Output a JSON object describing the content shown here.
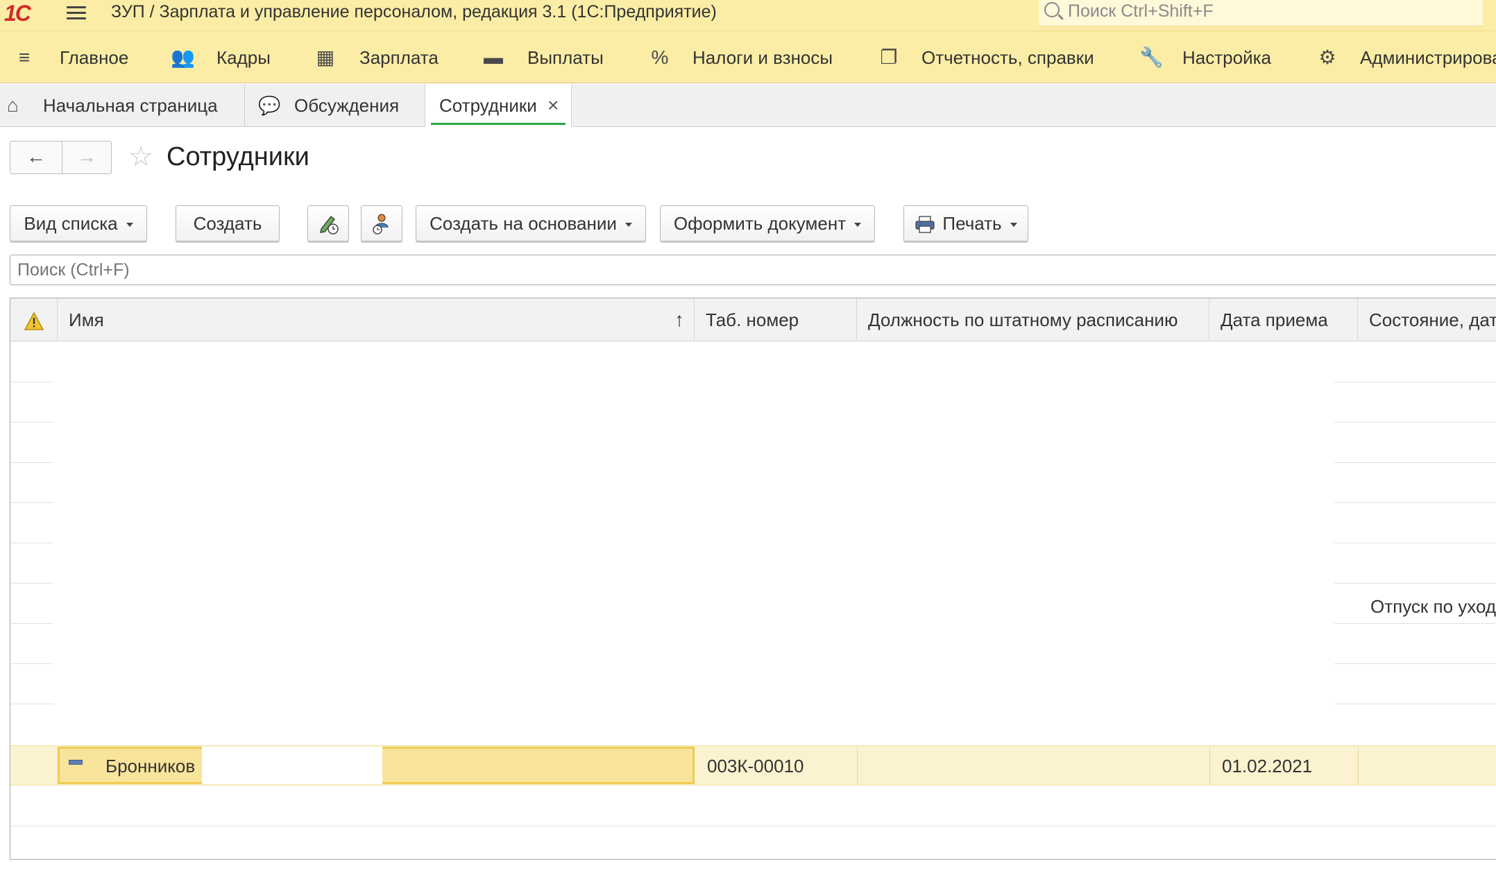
{
  "titlebar": {
    "logo": "1С",
    "title": "ЗУП / Зарплата и управление персоналом, редакция 3.1  (1С:Предприятие)",
    "search_placeholder": "Поиск Ctrl+Shift+F"
  },
  "sections": {
    "items": [
      {
        "label": "Главное",
        "icon": "menu-lines-icon"
      },
      {
        "label": "Кадры",
        "icon": "people-icon"
      },
      {
        "label": "Зарплата",
        "icon": "calculator-icon"
      },
      {
        "label": "Выплаты",
        "icon": "wallet-icon"
      },
      {
        "label": "Налоги и взносы",
        "icon": "percent-icon"
      },
      {
        "label": "Отчетность, справки",
        "icon": "documents-icon"
      },
      {
        "label": "Настройка",
        "icon": "wrench-icon"
      },
      {
        "label": "Администрирова",
        "icon": "gear-icon"
      }
    ]
  },
  "tabs": [
    {
      "label": "Начальная страница",
      "icon": "home-icon"
    },
    {
      "label": "Обсуждения",
      "icon": "chat-icon"
    },
    {
      "label": "Сотрудники",
      "active": true,
      "close": "×"
    }
  ],
  "form": {
    "back": "←",
    "forward": "→",
    "star": "☆",
    "title": "Сотрудники"
  },
  "toolbar": {
    "view_list": "Вид списка",
    "create": "Создать",
    "create_based_on": "Создать на основании",
    "make_document": "Оформить документ",
    "print": "Печать"
  },
  "search": {
    "placeholder": "Поиск (Ctrl+F)"
  },
  "table": {
    "columns": [
      "",
      "Имя",
      "Таб. номер",
      "Должность по штатному расписанию",
      "Дата приема",
      "Состояние, дат"
    ],
    "sort_indicator": "↑",
    "status_text": "Отпуск по уход",
    "selected_row": {
      "name": "Бронников",
      "tab_number": "003К-00010",
      "position": "",
      "hire_date": "01.02.2021"
    }
  },
  "colors": {
    "panel_yellow": "#fbeda5",
    "active_tab_underline": "#2aa845",
    "selection": "#f8e49a",
    "selection_border": "#f0cb55"
  }
}
